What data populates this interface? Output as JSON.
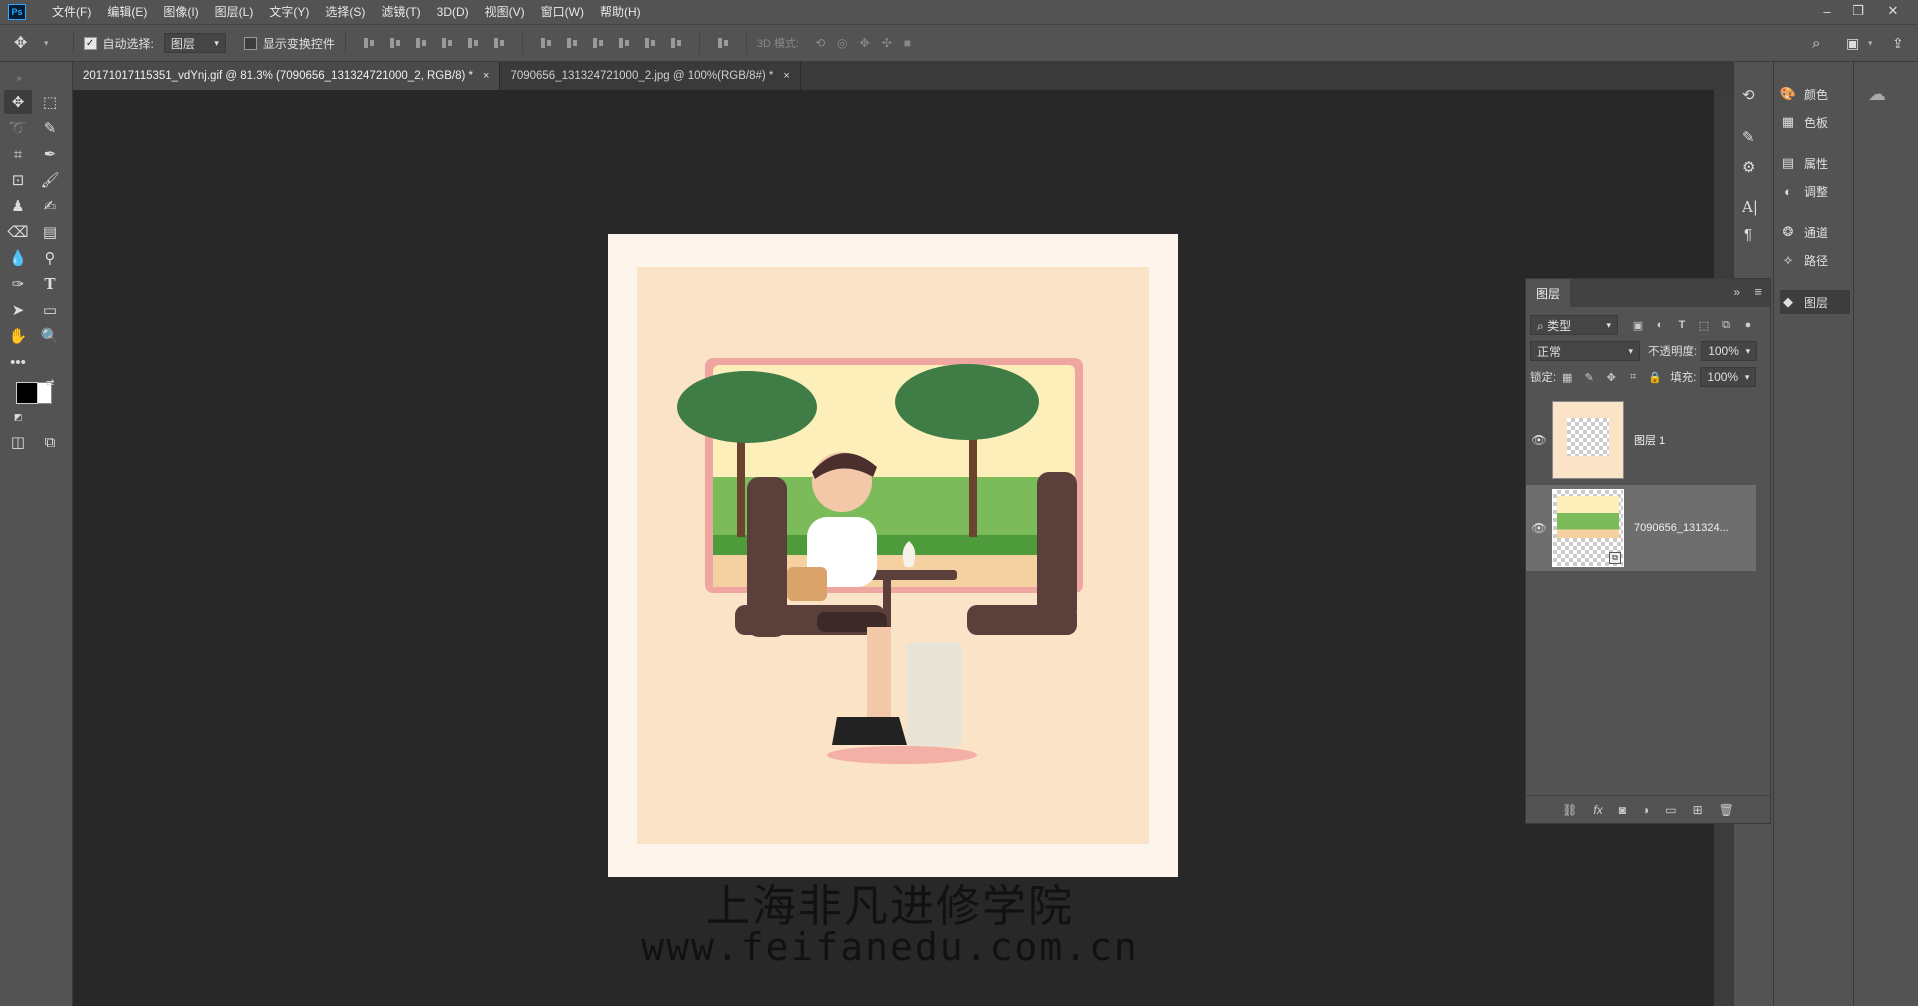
{
  "menubar": {
    "logo": "Ps",
    "items": [
      "文件(F)",
      "编辑(E)",
      "图像(I)",
      "图层(L)",
      "文字(Y)",
      "选择(S)",
      "滤镜(T)",
      "3D(D)",
      "视图(V)",
      "窗口(W)",
      "帮助(H)"
    ],
    "minimize": "–",
    "restore": "❐",
    "close": "✕"
  },
  "options": {
    "auto_select_label": "自动选择:",
    "auto_select_checked": true,
    "auto_select_target": "图层",
    "show_transform_label": "显示变换控件",
    "show_transform_checked": false,
    "mode_3d_label": "3D 模式:"
  },
  "tabs": [
    {
      "label": "20171017115351_vdYnj.gif @ 81.3% (7090656_131324721000_2, RGB/8) *",
      "active": true
    },
    {
      "label": "7090656_131324721000_2.jpg @ 100%(RGB/8#) *",
      "active": false
    }
  ],
  "tab_close_glyph": "×",
  "canvas": {
    "watermark_cn": "上海非凡进修学院",
    "watermark_en": "www.feifanedu.com.cn"
  },
  "dock": {
    "items": [
      {
        "icon": "palette-icon",
        "glyph": "🎨",
        "label": "颜色"
      },
      {
        "icon": "swatches-icon",
        "glyph": "▦",
        "label": "色板"
      },
      {
        "icon": "properties-icon",
        "glyph": "▤",
        "label": "属性"
      },
      {
        "icon": "adjustments-icon",
        "glyph": "◐",
        "label": "调整"
      },
      {
        "icon": "channels-icon",
        "glyph": "❂",
        "label": "通道"
      },
      {
        "icon": "paths-icon",
        "glyph": "⟡",
        "label": "路径"
      },
      {
        "icon": "layers-icon",
        "glyph": "◆",
        "label": "图层"
      }
    ]
  },
  "layers_panel": {
    "tab_label": "图层",
    "filter_kind": "类型",
    "blend_mode": "正常",
    "opacity_label": "不透明度:",
    "opacity_value": "100%",
    "lock_label": "锁定:",
    "fill_label": "填充:",
    "fill_value": "100%",
    "layers": [
      {
        "name": "图层 1",
        "visible": true,
        "selected": false
      },
      {
        "name": "7090656_131324...",
        "visible": true,
        "selected": true
      }
    ],
    "footer_icons": [
      "link-icon",
      "fx-icon",
      "mask-icon",
      "adjustment-layer-icon",
      "group-folder-icon",
      "new-layer-icon",
      "trash-icon"
    ],
    "footer_glyphs": [
      "⛓",
      "fx",
      "◙",
      "◑",
      "▭",
      "⊞",
      "🗑"
    ]
  },
  "colors": {
    "ui_panel": "#535353",
    "canvas_bg": "#282828",
    "doc_paper": "#fdf5ec",
    "doc_inner": "#fbe3c7",
    "arrow": "#ff2a2a",
    "foreground": "#000000",
    "background": "#ffffff"
  }
}
